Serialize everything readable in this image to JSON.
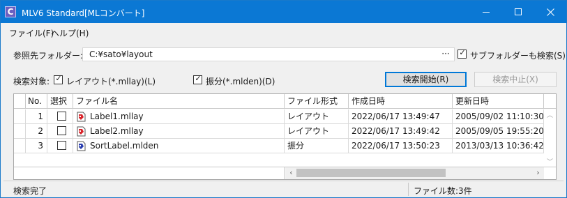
{
  "window": {
    "title": "MLV6 Standard[MLコンバート]",
    "icon_letter": "C"
  },
  "menu": {
    "items": [
      "ファイル(F)",
      "ヘルプ(H)"
    ]
  },
  "search": {
    "folder_label": "参照先フォルダー:",
    "folder_path": "C:¥sato¥layout",
    "browse_label": "···",
    "subfolder_label": "サブフォルダーも検索(S)",
    "subfolder_checked": true,
    "target_label": "検索対象:",
    "layout_label": "レイアウト(*.mllay)(L)",
    "layout_checked": true,
    "sort_label": "振分(*.mlden)(D)",
    "sort_checked": true,
    "start_button": "検索開始(R)",
    "stop_button": "検索中止(X)"
  },
  "grid": {
    "columns": [
      "No.",
      "選択",
      "ファイル名",
      "ファイル形式",
      "作成日時",
      "更新日時"
    ],
    "rows": [
      {
        "no": "1",
        "selected": false,
        "name": "Label1.mllay",
        "format": "レイアウト",
        "created": "2022/06/17 13:49:47",
        "updated": "2005/09/02 11:10:30",
        "icon": "layout-file-icon"
      },
      {
        "no": "2",
        "selected": false,
        "name": "Label2.mllay",
        "format": "レイアウト",
        "created": "2022/06/17 13:49:42",
        "updated": "2005/09/05 19:55:20",
        "icon": "layout-file-icon"
      },
      {
        "no": "3",
        "selected": false,
        "name": "SortLabel.mlden",
        "format": "振分",
        "created": "2022/06/17 13:50:23",
        "updated": "2013/03/13 10:36:42",
        "icon": "sort-file-icon"
      }
    ]
  },
  "status": {
    "message": "検索完了",
    "file_count": "ファイル数:3件"
  },
  "colors": {
    "titlebar": "#0b78d4",
    "accent": "#0078d7"
  }
}
